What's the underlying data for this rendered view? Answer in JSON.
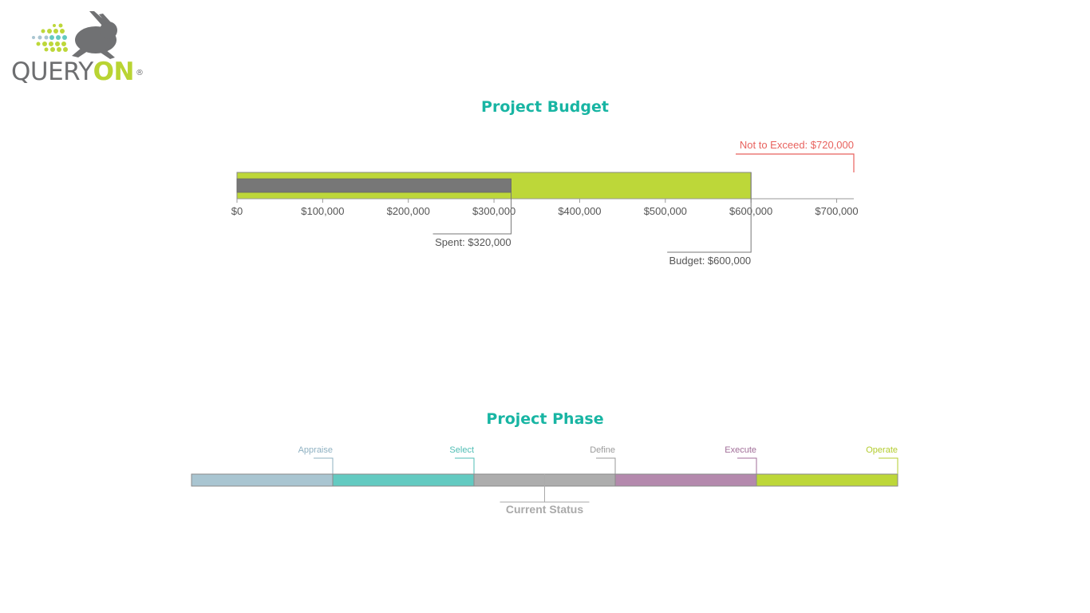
{
  "brand": {
    "name_part1": "QUERY",
    "name_part2": "ON",
    "registered": "®"
  },
  "chart_data": [
    {
      "type": "bar",
      "title": "Project Budget",
      "xlim": [
        0,
        720000
      ],
      "ticks": [
        0,
        100000,
        200000,
        300000,
        400000,
        500000,
        600000,
        700000
      ],
      "tick_labels": [
        "$0",
        "$100,000",
        "$200,000",
        "$300,000",
        "$400,000",
        "$500,000",
        "$600,000",
        "$700,000"
      ],
      "series": [
        {
          "name": "Budget",
          "value": 600000,
          "color": "#bdd739"
        },
        {
          "name": "Spent",
          "value": 320000,
          "color": "#777777"
        }
      ],
      "marker": {
        "value": 720000,
        "color": "#e8625e"
      },
      "annotations": {
        "spent": "Spent: $320,000",
        "budget": "Budget: $600,000",
        "not_to_exceed": "Not to Exceed: $720,000"
      },
      "colors": {
        "axis": "#999999",
        "label": "#555555",
        "leader": "#777777"
      }
    },
    {
      "type": "bar",
      "title": "Project Phase",
      "phases": [
        {
          "name": "Appraise",
          "color": "#a9c5d1",
          "label_color": "#8fb1c2"
        },
        {
          "name": "Select",
          "color": "#63cac1",
          "label_color": "#4fbdb4"
        },
        {
          "name": "Define",
          "color": "#adadad",
          "label_color": "#9a9a9a"
        },
        {
          "name": "Execute",
          "color": "#b489ad",
          "label_color": "#a16e98"
        },
        {
          "name": "Operate",
          "color": "#bdd739",
          "label_color": "#b3cc2e"
        }
      ],
      "current_status": {
        "label": "Current Status",
        "position": 2.5,
        "color": "#aaaaaa"
      }
    }
  ]
}
